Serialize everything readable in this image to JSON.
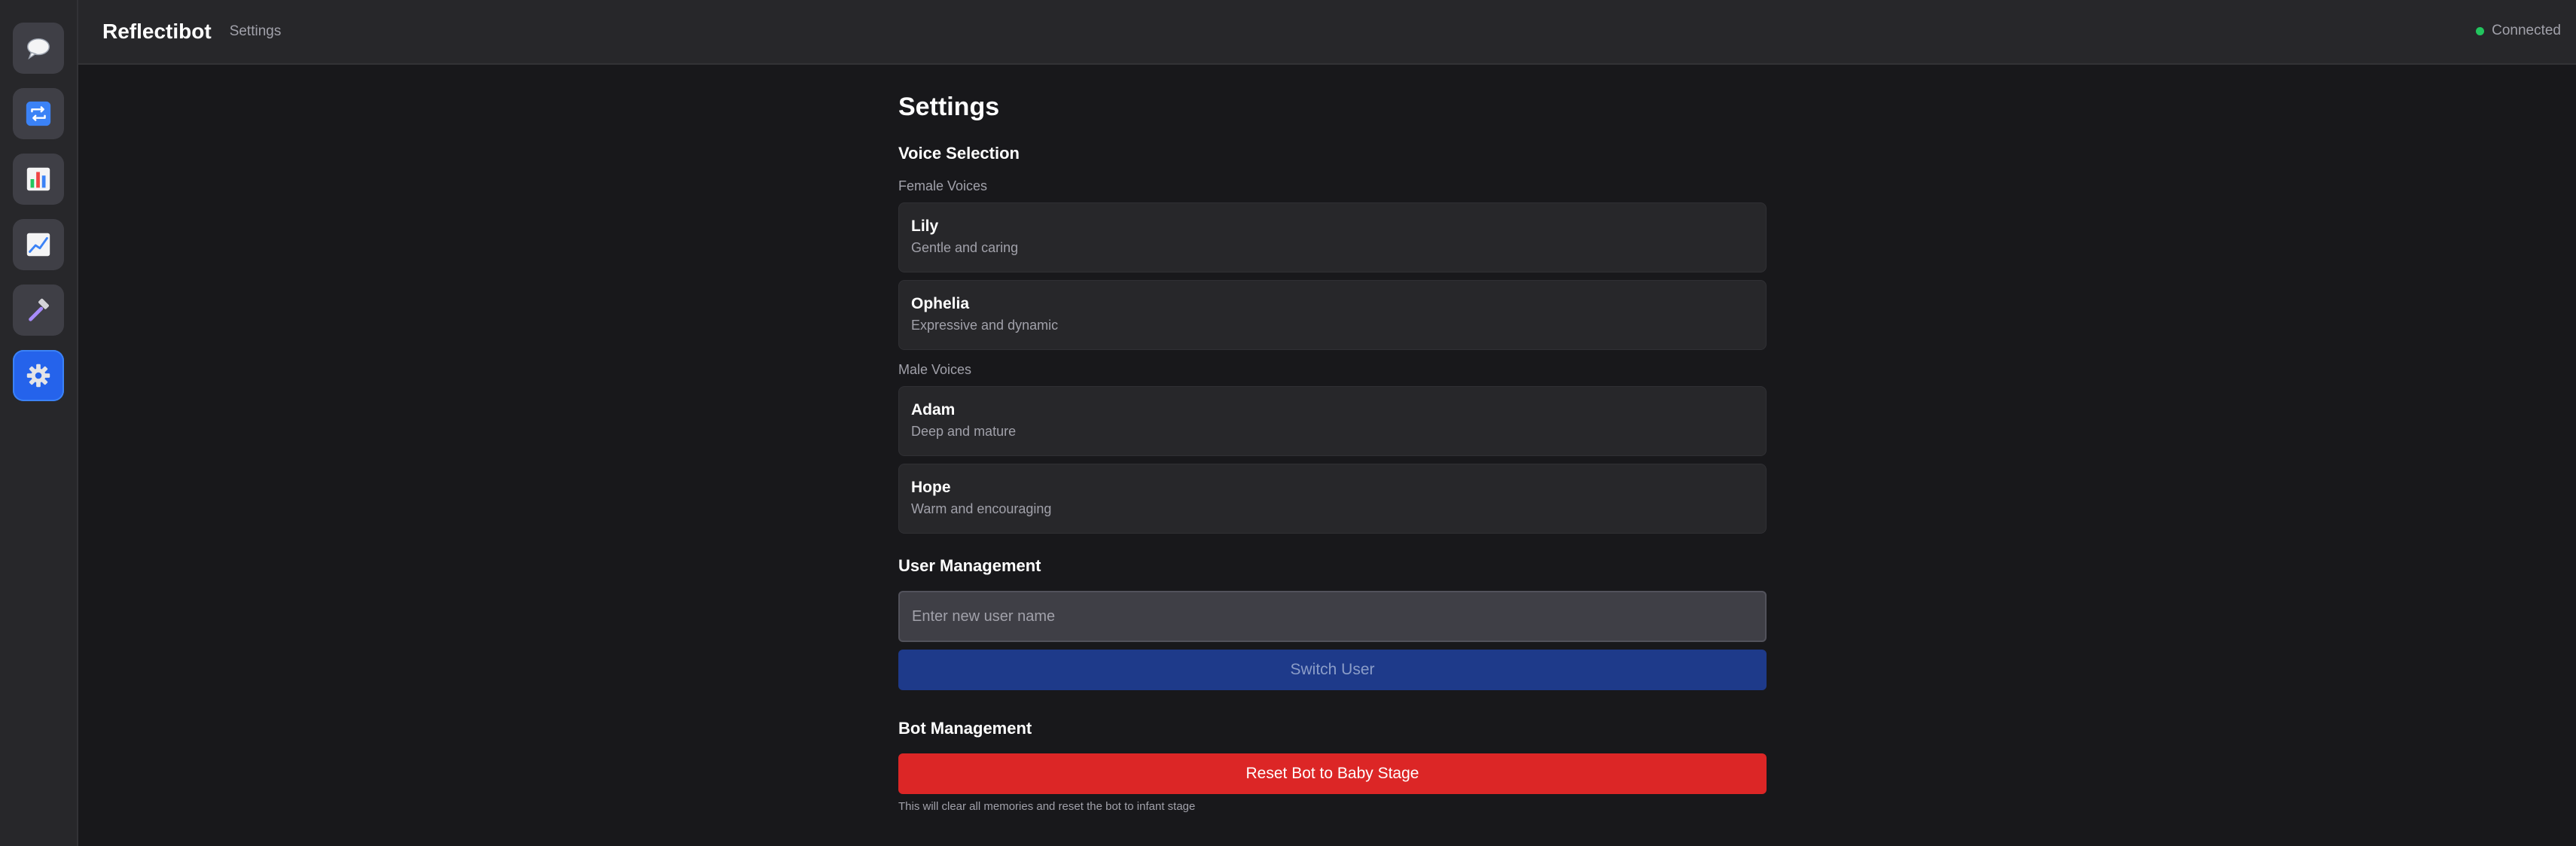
{
  "app": {
    "brand": "Reflectibot",
    "breadcrumb": "Settings",
    "status_text": "Connected",
    "status_color": "#22c55e"
  },
  "sidebar": {
    "items": [
      {
        "icon": "speech-bubble-icon",
        "active": false
      },
      {
        "icon": "repeat-icon",
        "active": false
      },
      {
        "icon": "bar-chart-icon",
        "active": false
      },
      {
        "icon": "trend-chart-icon",
        "active": false
      },
      {
        "icon": "hammer-icon",
        "active": false
      },
      {
        "icon": "gear-icon",
        "active": true
      }
    ]
  },
  "settings": {
    "title": "Settings",
    "voice_section": {
      "title": "Voice Selection",
      "female_label": "Female Voices",
      "male_label": "Male Voices",
      "female": [
        {
          "name": "Lily",
          "description": "Gentle and caring"
        },
        {
          "name": "Ophelia",
          "description": "Expressive and dynamic"
        }
      ],
      "male": [
        {
          "name": "Adam",
          "description": "Deep and mature"
        },
        {
          "name": "Hope",
          "description": "Warm and encouraging"
        }
      ]
    },
    "user_section": {
      "title": "User Management",
      "input_placeholder": "Enter new user name",
      "input_value": "",
      "switch_label": "Switch User"
    },
    "bot_section": {
      "title": "Bot Management",
      "reset_label": "Reset Bot to Baby Stage",
      "reset_hint": "This will clear all memories and reset the bot to infant stage"
    }
  },
  "colors": {
    "background": "#18181b",
    "panel": "#27272a",
    "accent": "#2563eb",
    "danger": "#dc2626",
    "switch_button": "#1e3a8a"
  }
}
